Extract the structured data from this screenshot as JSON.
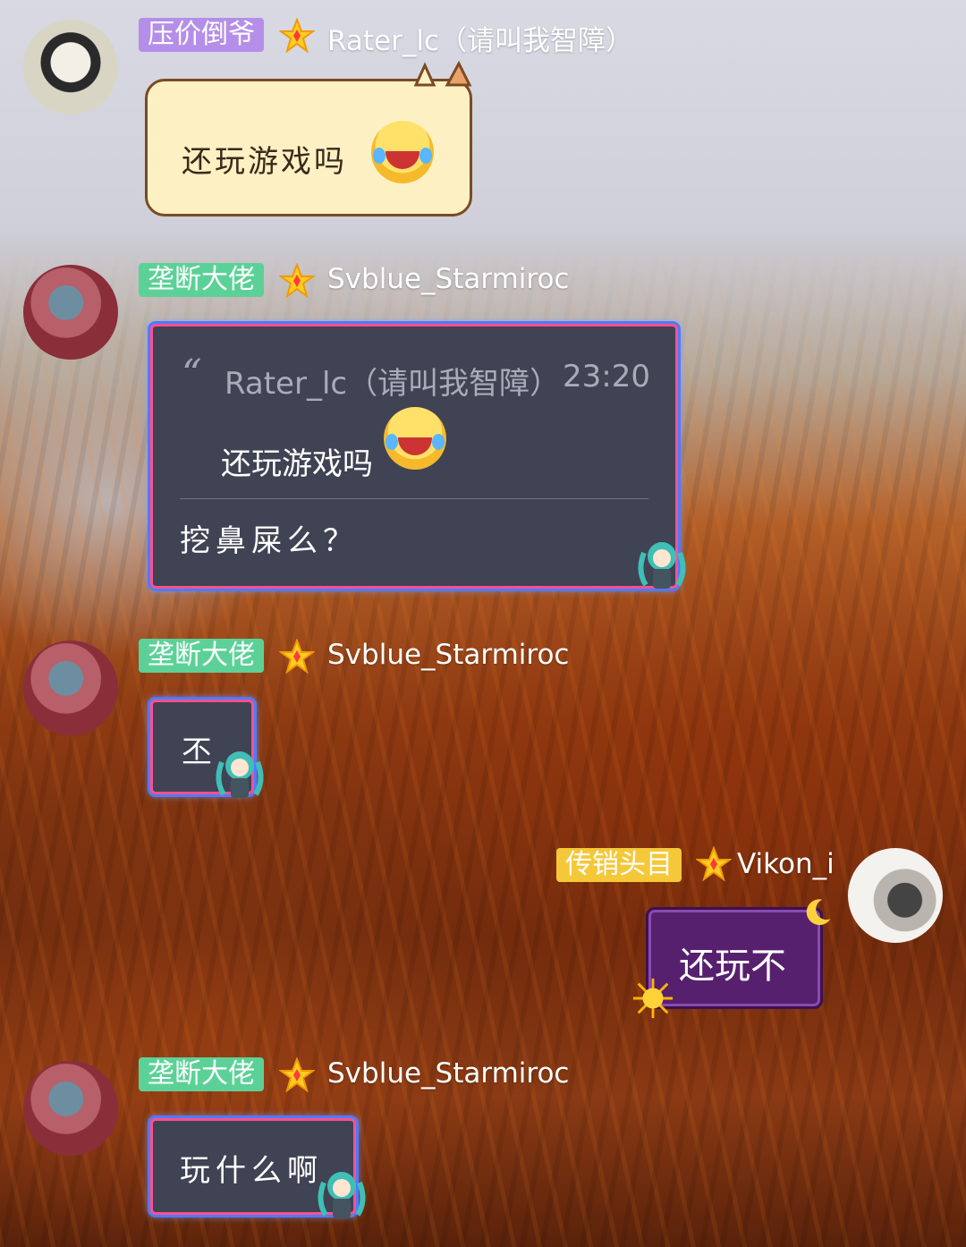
{
  "messages": [
    {
      "id": "msg1",
      "tag": "压价倒爷",
      "username": "Rater_lc（请叫我智障）",
      "text": "还玩游戏吗"
    },
    {
      "id": "msg2",
      "tag": "垄断大佬",
      "username": "Svblue_Starmiroc",
      "quote": {
        "author": "Rater_lc（请叫我智障）",
        "time": "23:20",
        "text": "还玩游戏吗"
      },
      "text": "挖鼻屎么？"
    },
    {
      "id": "msg3",
      "tag": "垄断大佬",
      "username": "Svblue_Starmiroc",
      "text": "丕"
    },
    {
      "id": "msg4",
      "tag": "传销头目",
      "username": "Vikon_i",
      "text": "还玩不"
    },
    {
      "id": "msg5",
      "tag": "垄断大佬",
      "username": "Svblue_Starmiroc",
      "text": "玩什么啊"
    }
  ],
  "colors": {
    "tag_purple": "#b48ee8",
    "tag_green": "#5cd197",
    "tag_yellow": "#f5c83a",
    "bubble_dark": "#3f4353",
    "bubble_border_pink": "#ff4f8f",
    "bubble_border_blue": "#4d7bff",
    "bubble_purple": "#56206f",
    "cat_bubble": "#fdf1c4"
  },
  "icons": {
    "rank_badge": "star-badge-icon",
    "emoji": "tears-of-joy-emoji",
    "sticker": "miku-sticker-icon",
    "avatar_1": "cat-avatar",
    "avatar_2": "miku-avatar",
    "avatar_3": "boy-avatar"
  }
}
